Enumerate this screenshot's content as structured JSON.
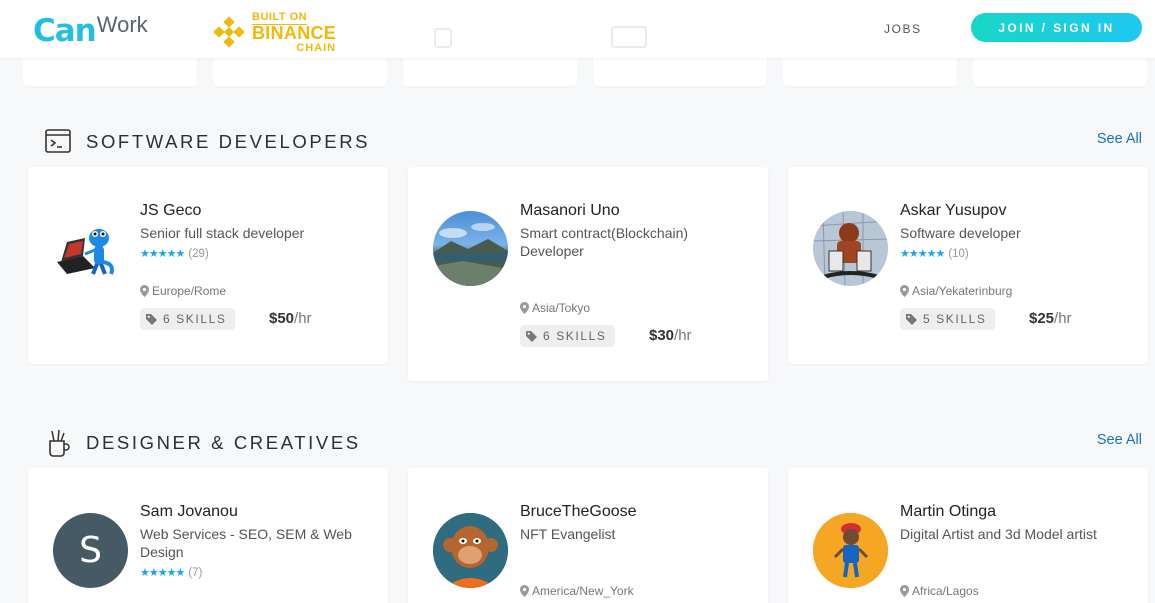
{
  "header": {
    "logo_can": "Can",
    "logo_work": "Work",
    "binance_line1": "BUILT ON",
    "binance_line2": "BINANCE",
    "binance_line3": "CHAIN",
    "nav_jobs": "JOBS",
    "join_label": "JOIN / SIGN IN"
  },
  "sections": [
    {
      "title": "SOFTWARE DEVELOPERS",
      "see_all": "See All",
      "cards": [
        {
          "name": "JS Geco",
          "role": "Senior full stack developer",
          "rating_count": "(29)",
          "location": "Europe/Rome",
          "skills": "6 SKILLS",
          "rate": "$50",
          "per": "/hr"
        },
        {
          "name": "Masanori Uno",
          "role": "Smart contract(Blockchain) Developer",
          "location": "Asia/Tokyo",
          "skills": "6 SKILLS",
          "rate": "$30",
          "per": "/hr"
        },
        {
          "name": "Askar Yusupov",
          "role": "Software developer",
          "rating_count": "(10)",
          "location": "Asia/Yekaterinburg",
          "skills": "5 SKILLS",
          "rate": "$25",
          "per": "/hr"
        }
      ]
    },
    {
      "title": "DESIGNER & CREATIVES",
      "see_all": "See All",
      "cards": [
        {
          "name": "Sam Jovanou",
          "role": "Web Services - SEO, SEM & Web Design",
          "rating_count": "(7)",
          "avatar_letter": "S"
        },
        {
          "name": "BruceTheGoose",
          "role": "NFT Evangelist",
          "location": "America/New_York"
        },
        {
          "name": "Martin Otinga",
          "role": "Digital Artist and 3d Model artist",
          "location": "Africa/Lagos"
        }
      ]
    }
  ],
  "stars": "★★★★★",
  "colors": {
    "accent": "#22bfe0",
    "link": "#1a73b8",
    "binance": "#f0b90b",
    "star": "#19a7e4"
  }
}
